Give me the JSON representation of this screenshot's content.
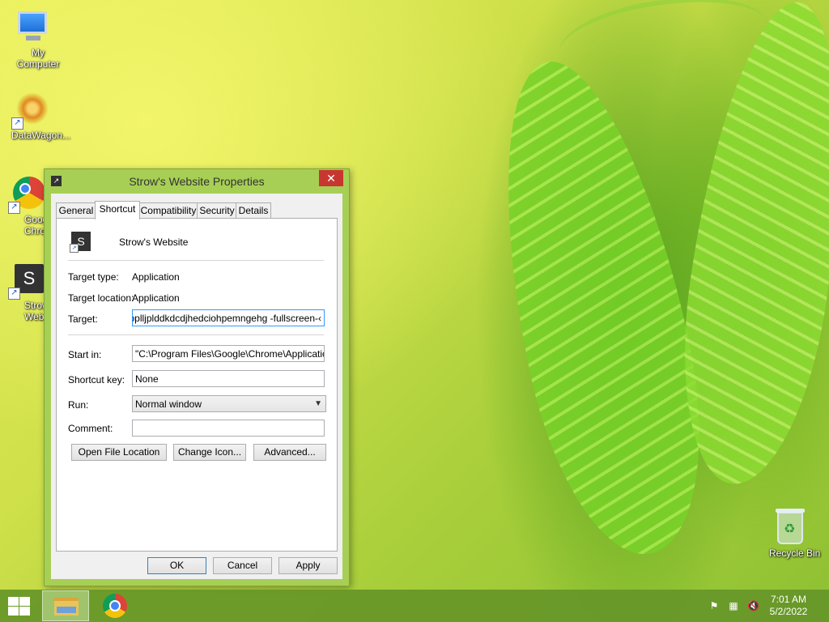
{
  "desktop": {
    "icons": [
      {
        "label": "My Computer",
        "icon": "my-computer-icon"
      },
      {
        "label": "DataWagon...",
        "icon": "datawagon-icon"
      },
      {
        "label": "Google Chrome",
        "label_visible": "Googl\nChrom",
        "icon": "chrome-icon"
      },
      {
        "label": "Strow's Website",
        "label_visible": "Strow'\nWebsit",
        "icon": "strows-website-icon"
      }
    ],
    "recycle_bin": {
      "label": "Recycle Bin",
      "icon": "recycle-bin-icon"
    }
  },
  "dialog": {
    "title": "Strow's Website Properties",
    "close_label": "✕",
    "tabs": [
      {
        "label": "General"
      },
      {
        "label": "Shortcut",
        "active": true
      },
      {
        "label": "Compatibility"
      },
      {
        "label": "Security"
      },
      {
        "label": "Details"
      }
    ],
    "shortcut_tab": {
      "app_name": "Strow's Website",
      "app_icon_letter": "S",
      "target_type_label": "Target type:",
      "target_type_value": "Application",
      "target_location_label": "Target location:",
      "target_location_value": "Application",
      "target_label": "Target:",
      "target_value": "›-id=fhlpplljplddkdcdjhedciohpemngehg -fullscreen",
      "start_in_label": "Start in:",
      "start_in_value": "\"C:\\Program Files\\Google\\Chrome\\Application\"",
      "shortcut_key_label": "Shortcut key:",
      "shortcut_key_value": "None",
      "run_label": "Run:",
      "run_value": "Normal window",
      "comment_label": "Comment:",
      "comment_value": "",
      "open_file_location_label": "Open File Location",
      "change_icon_label": "Change Icon...",
      "advanced_label": "Advanced..."
    },
    "footer": {
      "ok_label": "OK",
      "cancel_label": "Cancel",
      "apply_label": "Apply"
    }
  },
  "taskbar": {
    "clock_time": "7:01 AM",
    "clock_date": "5/2/2022",
    "tray_icons": [
      "action-center-flag-icon",
      "network-icon",
      "volume-muted-icon"
    ]
  }
}
